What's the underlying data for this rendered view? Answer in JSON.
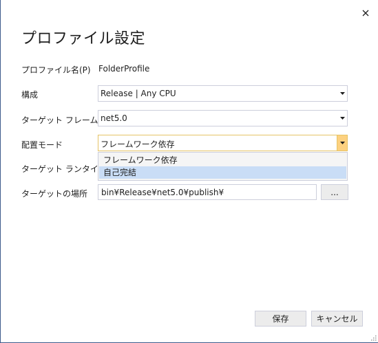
{
  "dialog": {
    "title": "プロファイル設定",
    "close_label": "✕"
  },
  "fields": {
    "profile_name": {
      "label": "プロファイル名(P)",
      "value": "FolderProfile"
    },
    "configuration": {
      "label": "構成",
      "value": "Release | Any CPU"
    },
    "target_framework": {
      "label": "ターゲット フレームワーク",
      "value": "net5.0"
    },
    "deployment_mode": {
      "label": "配置モード",
      "value": "フレームワーク依存",
      "options": [
        "フレームワーク依存",
        "自己完結"
      ],
      "hovered_option": "自己完結"
    },
    "target_runtime": {
      "label": "ターゲット ランタイム"
    },
    "target_location": {
      "label": "ターゲットの場所",
      "value": "bin¥Release¥net5.0¥publish¥",
      "browse_label": "..."
    }
  },
  "footer": {
    "save_label": "保存",
    "cancel_label": "キャンセル"
  },
  "icons": {
    "dropdown_arrow": "chevron-down-icon",
    "close": "close-icon",
    "resize": "resize-grip-icon"
  },
  "colors": {
    "window_border": "#3c5a8a",
    "control_border": "#cccedb",
    "open_border": "#e5c365",
    "open_arrow_bg": "#fdd180",
    "hover_item": "#c9ddf6",
    "button_bg": "#ececec"
  }
}
